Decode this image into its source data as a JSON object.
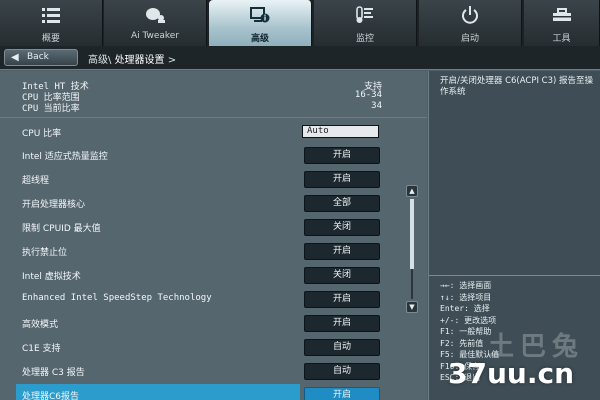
{
  "tabs": [
    {
      "label": "概要",
      "icon": "list-icon"
    },
    {
      "label": "Ai Tweaker",
      "icon": "tweaker-icon"
    },
    {
      "label": "高级",
      "icon": "advanced-icon"
    },
    {
      "label": "监控",
      "icon": "monitor-icon"
    },
    {
      "label": "启动",
      "icon": "power-icon"
    },
    {
      "label": "工具",
      "icon": "tool-icon"
    }
  ],
  "active_tab": "高级",
  "back_label": "Back",
  "breadcrumb": {
    "parent": "高级\\",
    "current": "处理器设置",
    "suffix": ">"
  },
  "info": [
    {
      "label": "Intel HT 技术",
      "value": "支持"
    },
    {
      "label": "CPU 比率范围",
      "value": "16-34"
    },
    {
      "label": "CPU 当前比率",
      "value": "34"
    }
  ],
  "options": [
    {
      "label": "CPU 比率",
      "value": "Auto"
    },
    {
      "label": "Intel 适应式热量监控",
      "value": "开启"
    },
    {
      "label": "超线程",
      "value": "开启"
    },
    {
      "label": "开启处理器核心",
      "value": "全部"
    },
    {
      "label": "限制 CPUID 最大值",
      "value": "关闭"
    },
    {
      "label": "执行禁止位",
      "value": "开启"
    },
    {
      "label": "Intel 虚拟技术",
      "value": "关闭"
    },
    {
      "label": "Enhanced Intel SpeedStep Technology",
      "value": "开启"
    },
    {
      "label": "高效模式",
      "value": "开启"
    },
    {
      "label": "C1E 支持",
      "value": "自动"
    },
    {
      "label": "处理器 C3 报告",
      "value": "自动"
    },
    {
      "label": "处理器C6报告",
      "value": "开启"
    }
  ],
  "selected_option": "处理器C6报告",
  "scroll_position": 0.6,
  "help": {
    "description": "开启/关闭处理器 C6(ACPI C3) 报告至操作系统",
    "keys": [
      "→←: 选择画面",
      "↑↓: 选择项目",
      "Enter: 选择",
      "+/-: 更改选项",
      "F1: 一般帮助",
      "F2: 先前值",
      "F5: 最佳默认值",
      "F10: 保存",
      "ESC: 退出"
    ]
  },
  "watermark": {
    "text": "37uu.cn",
    "ghost": "土巴兔"
  },
  "colors": {
    "active_tab": "#c7dde4",
    "selected_row": "#2b9ccb",
    "panel_bg": "#56666f"
  }
}
